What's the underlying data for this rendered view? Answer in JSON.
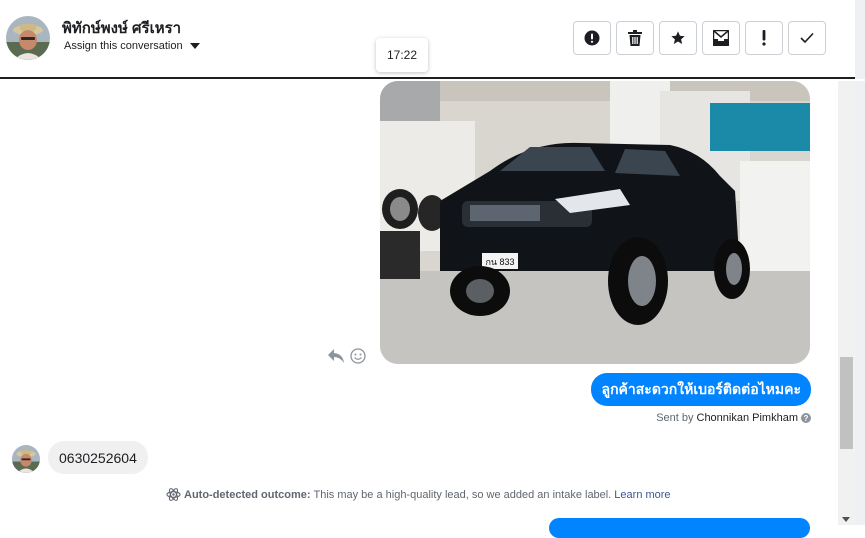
{
  "header": {
    "contact_name": "พิทักษ์พงษ์ ศรีเหรา",
    "assign_label": "Assign this conversation",
    "tooltip_time": "17:22",
    "actions": [
      {
        "name": "spam-button",
        "icon": "exclamation-circle-icon"
      },
      {
        "name": "delete-button",
        "icon": "trash-icon"
      },
      {
        "name": "star-button",
        "icon": "star-icon"
      },
      {
        "name": "mark-unread-button",
        "icon": "envelope-icon"
      },
      {
        "name": "follow-up-button",
        "icon": "exclamation-icon"
      },
      {
        "name": "done-button",
        "icon": "check-icon"
      }
    ]
  },
  "thread": {
    "image_message": {
      "type": "photo",
      "plate_text": "กน 833"
    },
    "outgoing_message": "ลูกค้าสะดวกให้เบอร์ติดต่อไหมคะ",
    "sent_by_prefix": "Sent by",
    "sent_by_name": "Chonnikan Pimkham",
    "incoming_message": "0630252604",
    "outcome": {
      "label": "Auto-detected outcome:",
      "text": "This may be a high-quality lead, so we added an intake label.",
      "link": "Learn more"
    }
  },
  "colors": {
    "accent": "#0084ff",
    "incoming_bubble": "#f0f0f0",
    "link": "#385898"
  }
}
